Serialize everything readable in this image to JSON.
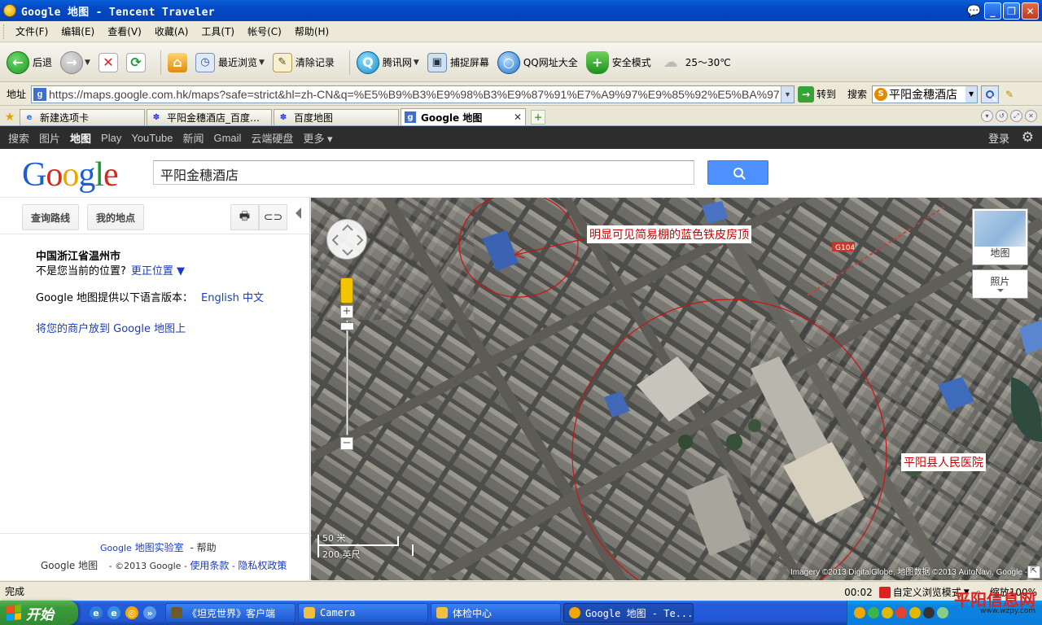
{
  "window": {
    "title": "Google 地图 - Tencent Traveler"
  },
  "menu": [
    "文件(F)",
    "编辑(E)",
    "查看(V)",
    "收藏(A)",
    "工具(T)",
    "帐号(C)",
    "帮助(H)"
  ],
  "toolbar": {
    "back": "后退",
    "recent": "最近浏览",
    "clear": "清除记录",
    "tencent": "腾讯网",
    "capture": "捕捉屏幕",
    "qq_nav": "QQ网址大全",
    "safe_mode": "安全模式",
    "weather": "25～30℃"
  },
  "address": {
    "label": "地址",
    "url": "https://maps.google.com.hk/maps?safe=strict&hl=zh-CN&q=%E5%B9%B3%E9%98%B3%E9%87%91%E7%A9%97%E9%85%92%E5%BA%97",
    "go": "转到",
    "search_label": "搜索",
    "search_value": "平阳金穗酒店"
  },
  "tabs": [
    {
      "label": "新建选项卡",
      "icon": "ie-icon"
    },
    {
      "label": "平阳金穗酒店_百度…",
      "icon": "baidu-icon"
    },
    {
      "label": "百度地图",
      "icon": "baidu-icon"
    },
    {
      "label": "Google 地图",
      "icon": "google-icon",
      "active": true
    }
  ],
  "gbar": {
    "items": [
      "搜索",
      "图片",
      "地图",
      "Play",
      "YouTube",
      "新闻",
      "Gmail",
      "云端硬盘",
      "更多 ▾"
    ],
    "active_index": 2,
    "login": "登录"
  },
  "google": {
    "logo_letters": [
      "G",
      "o",
      "o",
      "g",
      "l",
      "e"
    ],
    "search_value": "平阳金穗酒店"
  },
  "left": {
    "directions_btn": "查询路线",
    "myplaces_btn": "我的地点",
    "location_title": "中国浙江省温州市",
    "location_question": "不是您当前的位置?",
    "location_fix": "更正位置 ▼",
    "lang_text": "Google 地图提供以下语言版本：",
    "lang_en": "English",
    "lang_zh": "中文",
    "business": "将您的商户放到  Google 地图上",
    "footer_lab": "Google",
    "footer_lab2": "地图实验室",
    "footer_help": "- 帮助",
    "footer_brand": "Google 地图",
    "footer_copy": "- ©2013 Google -",
    "footer_terms": "使用条款",
    "footer_sep": "-",
    "footer_privacy": "隐私权政策"
  },
  "map": {
    "annotation_roof": "明显可见简易棚的蓝色铁皮房顶",
    "annotation_hospital": "平阳县人民医院",
    "maptype_map": "地图",
    "maptype_photo": "照片",
    "scale_metric": "50 米",
    "scale_imperial": "200 英尺",
    "attribution": "Imagery ©2013 DigitalGlobe, 地图数据 ©2013 AutoNavi, Google -",
    "road_label": "G104",
    "circle_color": "#c81414"
  },
  "status": {
    "text": "完成",
    "time": "00:02",
    "mode": "自定义浏览模式",
    "zoom": "缩放100%"
  },
  "taskbar": {
    "start": "开始",
    "items": [
      {
        "label": "《坦克世界》客户端"
      },
      {
        "label": "Camera"
      },
      {
        "label": "体检中心"
      },
      {
        "label": "Google 地图 - Te..."
      }
    ]
  },
  "watermark": {
    "name": "平阳信息网",
    "url": "www.wzpy.com"
  }
}
